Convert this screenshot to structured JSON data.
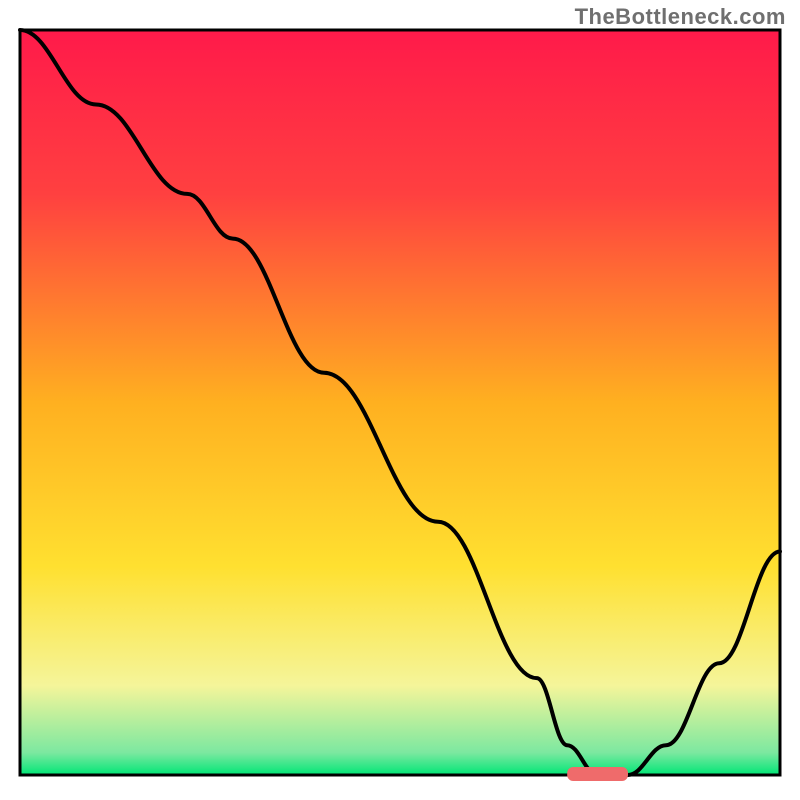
{
  "watermark": "TheBottleneck.com",
  "colors": {
    "gradient_top": "#ff1a4a",
    "gradient_mid": "#ffca28",
    "gradient_low": "#f5f59a",
    "gradient_bottom": "#00e676",
    "curve": "#000000",
    "marker": "#ef6b6b",
    "frame": "#000000"
  },
  "chart_data": {
    "type": "line",
    "title": "",
    "xlabel": "",
    "ylabel": "",
    "xlim": [
      0,
      100
    ],
    "ylim": [
      0,
      100
    ],
    "curve": {
      "name": "bottleneck-curve",
      "x": [
        0,
        10,
        22,
        28,
        40,
        55,
        68,
        72,
        76,
        80,
        85,
        92,
        100
      ],
      "y": [
        100,
        90,
        78,
        72,
        54,
        34,
        13,
        4,
        0,
        0,
        4,
        15,
        30
      ]
    },
    "optimal_marker": {
      "x_start": 72,
      "x_end": 80,
      "y": 0
    },
    "gradient_stops": [
      {
        "offset": 0.0,
        "color": "#ff1a4a"
      },
      {
        "offset": 0.22,
        "color": "#ff4040"
      },
      {
        "offset": 0.5,
        "color": "#ffb020"
      },
      {
        "offset": 0.72,
        "color": "#ffe030"
      },
      {
        "offset": 0.88,
        "color": "#f5f59a"
      },
      {
        "offset": 0.97,
        "color": "#7ce8a0"
      },
      {
        "offset": 1.0,
        "color": "#00e676"
      }
    ]
  }
}
